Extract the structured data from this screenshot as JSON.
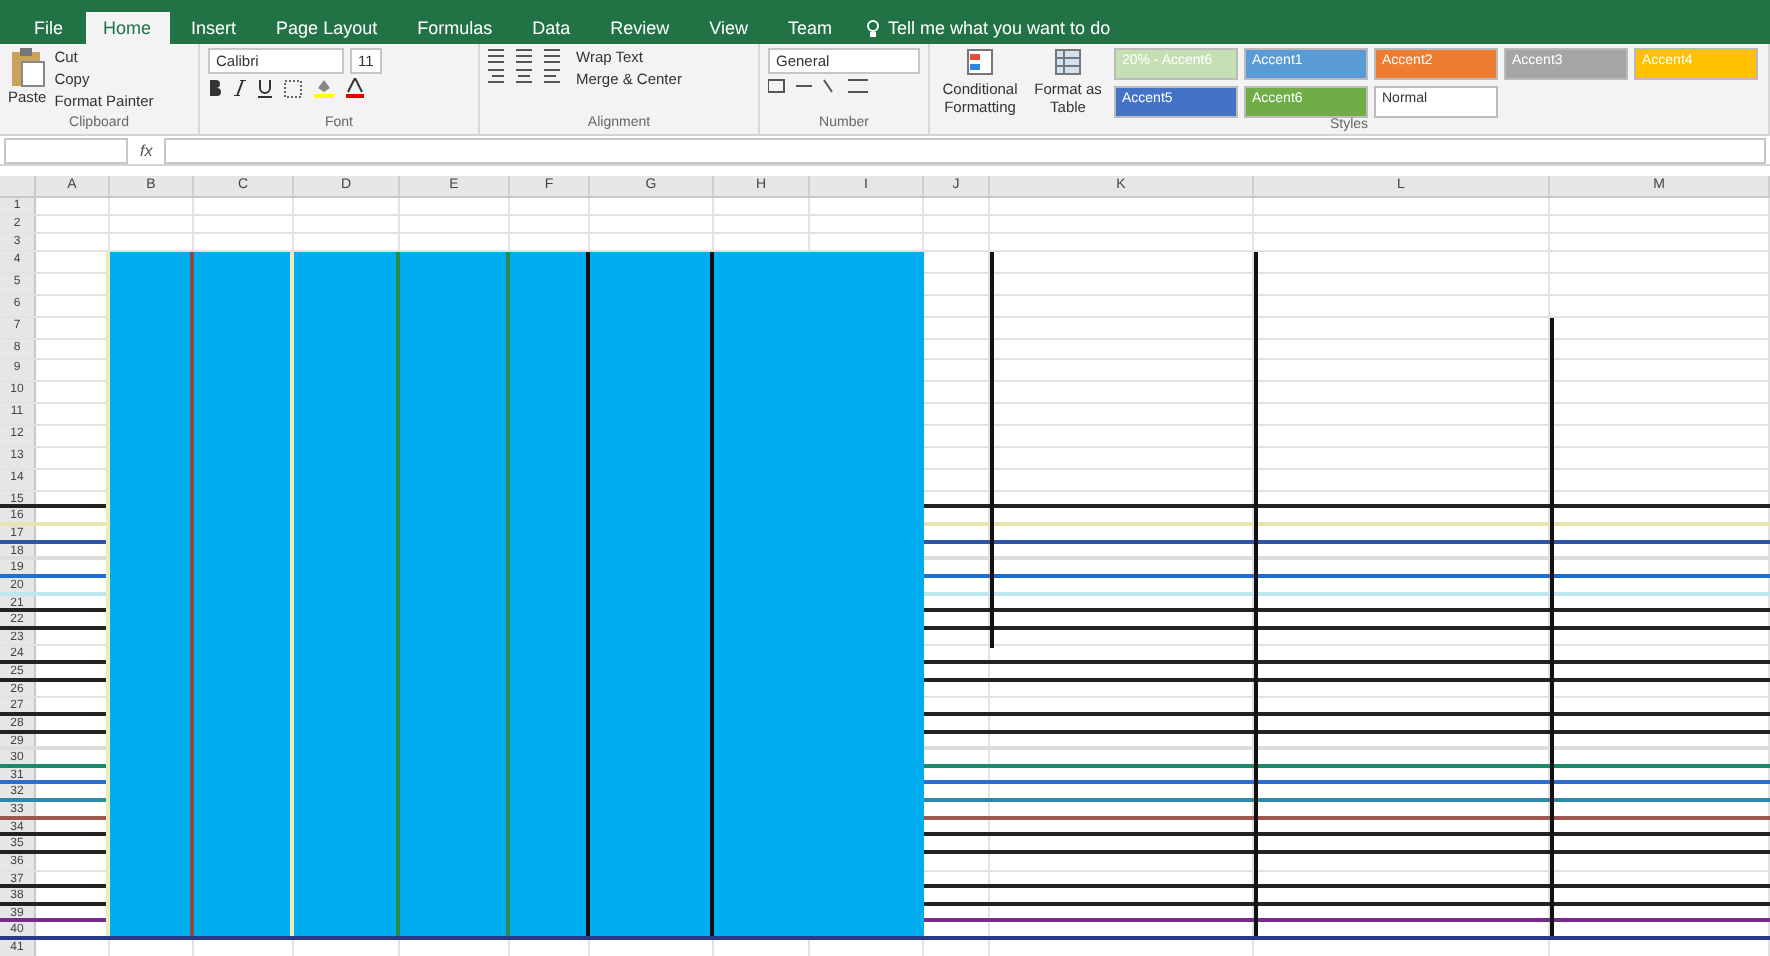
{
  "tabs": [
    {
      "label": "File",
      "selected": false
    },
    {
      "label": "Home",
      "selected": true
    },
    {
      "label": "Insert",
      "selected": false
    },
    {
      "label": "Page Layout",
      "selected": false
    },
    {
      "label": "Formulas",
      "selected": false
    },
    {
      "label": "Data",
      "selected": false
    },
    {
      "label": "Review",
      "selected": false
    },
    {
      "label": "View",
      "selected": false
    },
    {
      "label": "Team",
      "selected": false
    }
  ],
  "tell_me": "Tell me what you want to do",
  "clipboard": {
    "paste": "Paste",
    "items": [
      "Cut",
      "Copy",
      "Format Painter"
    ],
    "label": "Clipboard"
  },
  "font": {
    "name": "Calibri",
    "size": "11",
    "label": "Font"
  },
  "alignment": {
    "wrap": "Wrap Text",
    "merge": "Merge & Center",
    "label": "Alignment"
  },
  "number": {
    "format": "General",
    "label": "Number"
  },
  "styles": {
    "conditional": "Conditional Formatting",
    "table": "Format as Table",
    "label": "Styles",
    "cells": [
      {
        "label": "20% - Accent6",
        "color": "#c6e0b4"
      },
      {
        "label": "Accent1",
        "color": "#5b9bd5"
      },
      {
        "label": "Accent2",
        "color": "#ed7d31"
      },
      {
        "label": "Accent3",
        "color": "#a5a5a5"
      },
      {
        "label": "Accent4",
        "color": "#ffc000"
      },
      {
        "label": "Accent5",
        "color": "#4472c4"
      },
      {
        "label": "Accent6",
        "color": "#70ad47"
      },
      {
        "label": "Normal",
        "color": "#ffffff"
      }
    ]
  },
  "formula_bar": {
    "fx": "fx"
  },
  "columns": [
    "A",
    "B",
    "C",
    "D",
    "E",
    "F",
    "G",
    "H",
    "I",
    "J",
    "K",
    "L",
    "M"
  ],
  "rows": [
    "1",
    "2",
    "3",
    "4",
    "5",
    "6",
    "7",
    "8",
    "9",
    "10",
    "11",
    "12",
    "13",
    "14",
    "15",
    "16",
    "17",
    "18",
    "19",
    "20",
    "21",
    "22",
    "23",
    "24",
    "25",
    "26",
    "27",
    "28",
    "29",
    "30",
    "31",
    "32",
    "33",
    "34",
    "35",
    "36",
    "37",
    "38",
    "39",
    "40",
    "41"
  ]
}
